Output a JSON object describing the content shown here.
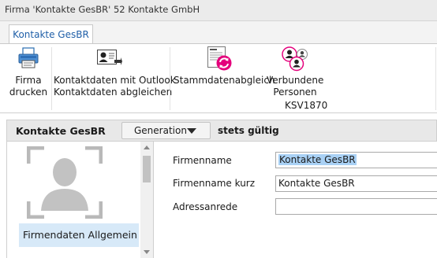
{
  "window": {
    "title": "Firma 'Kontakte GesBR' 52 Kontakte GmbH"
  },
  "ribbon": {
    "tab": "Kontakte GesBR",
    "buttons": {
      "print": "Firma\ndrucken",
      "outlook": "Kontaktdaten mit Outlook\nKontaktdaten abgleichen",
      "stammdaten": "Stammdatenabgleich",
      "verbundene": "Verbundene\nPersonen"
    },
    "group_label": "KSV1870"
  },
  "panel": {
    "title": "Kontakte GesBR",
    "generation_button": "Generation",
    "validity": "stets gültig"
  },
  "sidebar": {
    "items": [
      {
        "label": "Firmendaten Allgemein",
        "selected": true
      }
    ]
  },
  "form": {
    "fields": [
      {
        "label": "Firmenname",
        "value": "Kontakte GesBR",
        "selected": true
      },
      {
        "label": "Firmenname kurz",
        "value": "Kontakte GesBR"
      },
      {
        "label": "Adressanrede",
        "value": ""
      }
    ]
  },
  "colors": {
    "accent": "#1f5fa8",
    "selection": "#d7e9f8",
    "highlight": "#e4007c"
  }
}
